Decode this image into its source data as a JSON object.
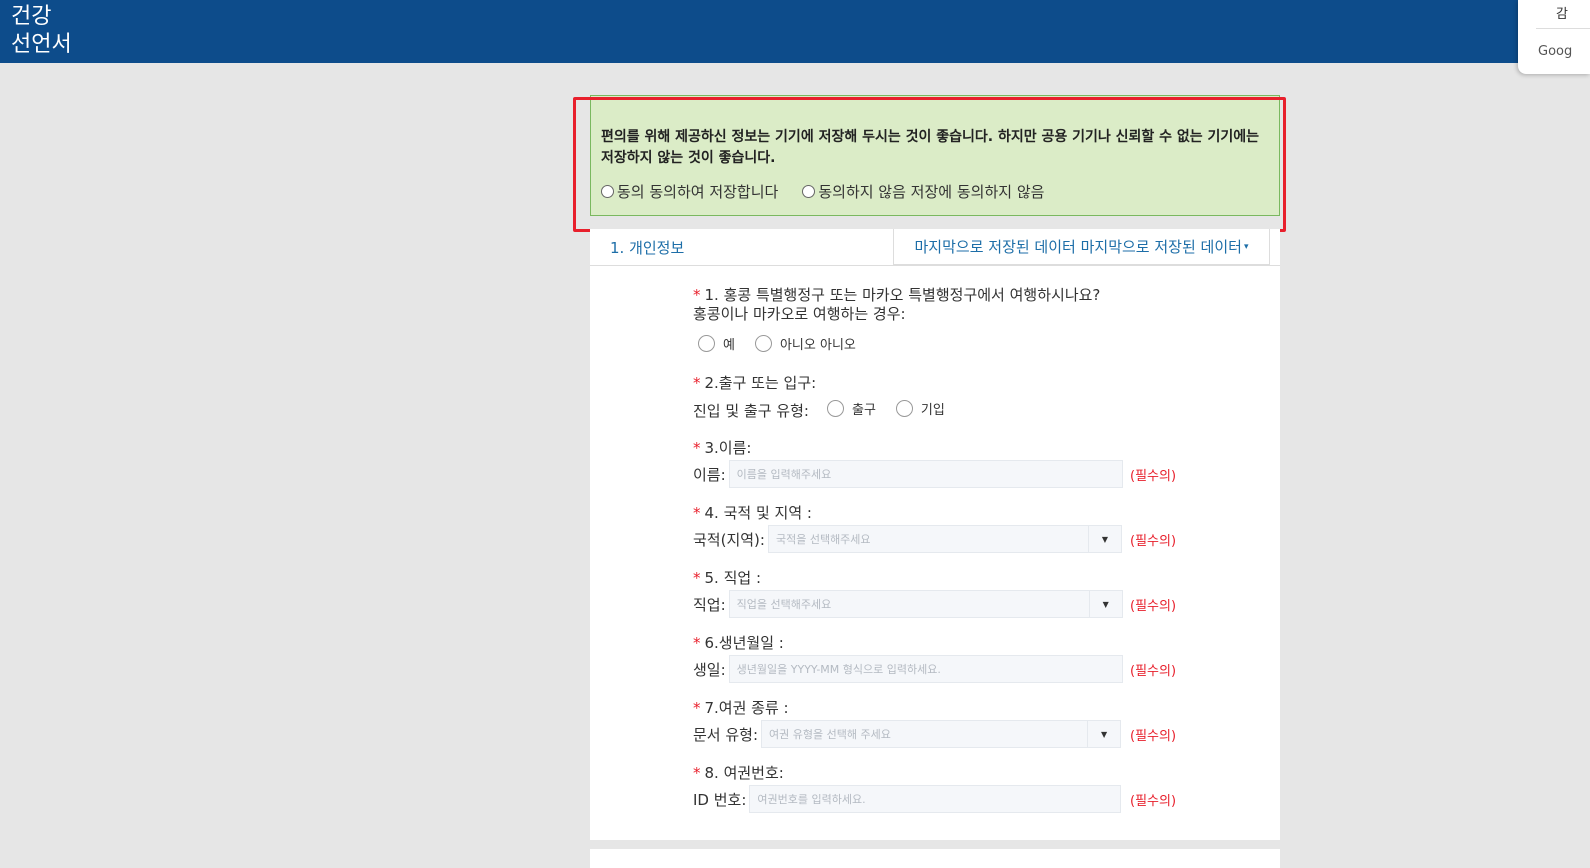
{
  "header": {
    "brand_line1": "건강",
    "brand_line2": "선언서",
    "bg_color": "#0d4c8b"
  },
  "google_popup": {
    "line1": "감",
    "line2": "Goog"
  },
  "consent": {
    "message": "편의를 위해 제공하신 정보는 기기에 저장해 두시는 것이 좋습니다. 하지만 공용 기기나 신뢰할 수 없는 기기에는 저장하지 않는 것이 좋습니다.",
    "agree_label": "동의 동의하여 저장합니다",
    "disagree_label": "동의하지 않음 저장에 동의하지 않음"
  },
  "section": {
    "tab_label": "1. 개인정보",
    "saved_dropdown_label": "마지막으로 저장된 데이터 마지막으로 저장된 데이터",
    "saved_dropdown_caret": "▾"
  },
  "required_mark": "*",
  "required_note": "(필수의)",
  "dropdown_caret": "▼",
  "questions": {
    "q1": {
      "title": "1. 홍콩 특별행정구 또는 마카오 특별행정구에서 여행하시나요?",
      "sub": "홍콩이나 마카오로 여행하는 경우:",
      "options": [
        "예",
        "아니오 아니오"
      ]
    },
    "q2": {
      "title": "2.출구 또는 입구:",
      "sub": "진입 및 출구 유형:",
      "options": [
        "출구",
        "기입"
      ]
    },
    "q3": {
      "title": "3.이름:",
      "label": "이름:",
      "placeholder": "이름을 입력해주세요"
    },
    "q4": {
      "title": "4. 국적 및 지역 :",
      "label": "국적(지역):",
      "placeholder": "국적을 선택해주세요"
    },
    "q5": {
      "title": "5. 직업 :",
      "label": "직업:",
      "placeholder": "직업을 선택해주세요"
    },
    "q6": {
      "title": "6.생년월일 :",
      "label": "생일:",
      "placeholder": "생년월일을 YYYY-MM 형식으로 입력하세요."
    },
    "q7": {
      "title": "7.여권 종류 :",
      "label": "문서 유형:",
      "placeholder": "여권 유형을 선택해 주세요"
    },
    "q8": {
      "title": "8. 여권번호:",
      "label": "ID 번호:",
      "placeholder": "여권번호를 입력하세요."
    }
  }
}
